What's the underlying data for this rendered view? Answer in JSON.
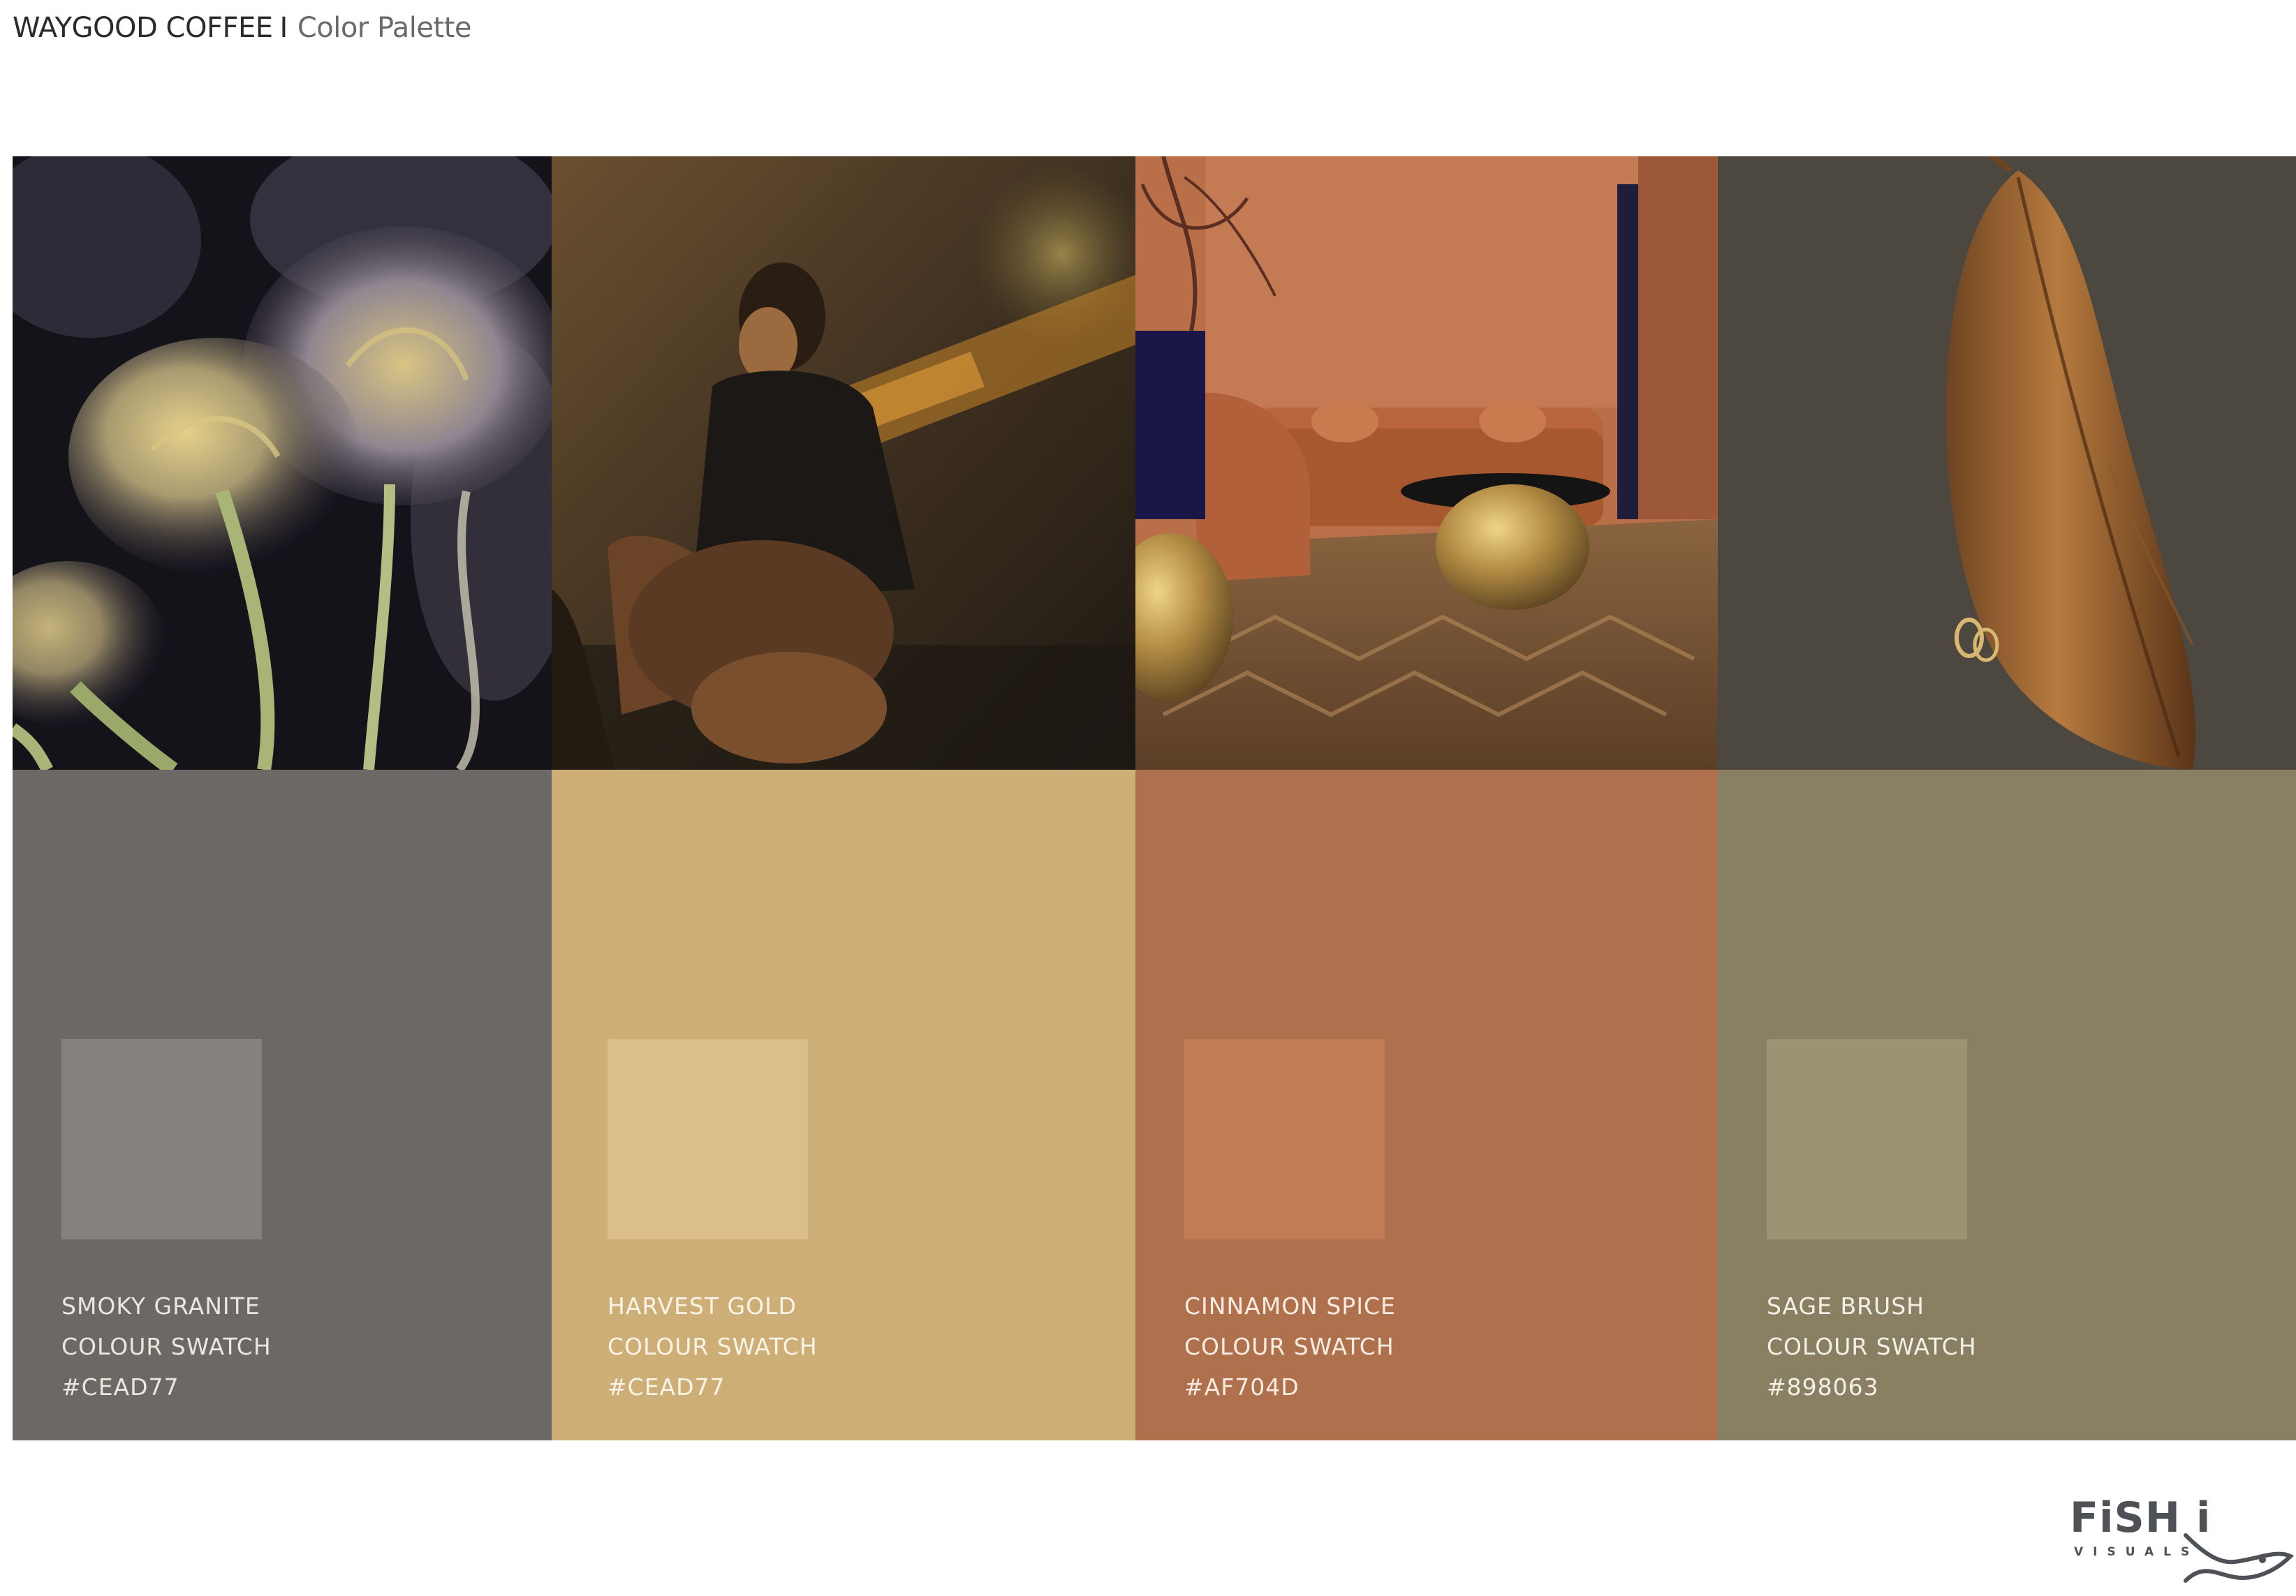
{
  "header": {
    "brand": "WAYGOOD COFFEE",
    "separator": "I",
    "subtitle": "Color Palette"
  },
  "palette": [
    {
      "image_icon": "dried-tulips-photo",
      "name": "SMOKY GRANITE",
      "label": "COLOUR SWATCH",
      "hex_text": "#CEAD77",
      "panel_color": "#6b6865",
      "chip_color": "#85817c",
      "text_color": "#ebe6de"
    },
    {
      "image_icon": "woman-in-light-photo",
      "name": "HARVEST GOLD",
      "label": "COLOUR SWATCH",
      "hex_text": "#CEAD77",
      "panel_color": "#ceae77",
      "chip_color": "#dcbe88",
      "text_color": "#fbf4e6"
    },
    {
      "image_icon": "terracotta-living-room-photo",
      "name": "CINNAMON SPICE",
      "label": "COLOUR SWATCH",
      "hex_text": "#AF704D",
      "panel_color": "#af704d",
      "chip_color": "#c17b55",
      "text_color": "#fbece2"
    },
    {
      "image_icon": "dried-leaf-photo",
      "name": "SAGE BRUSH",
      "label": "COLOUR SWATCH",
      "hex_text": "#898063",
      "panel_color": "#898063",
      "chip_color": "#9c9375",
      "text_color": "#f3f0e6"
    }
  ],
  "logo": {
    "word": "FiSH i",
    "sub": "VISUALS",
    "icon": "fish-icon"
  }
}
